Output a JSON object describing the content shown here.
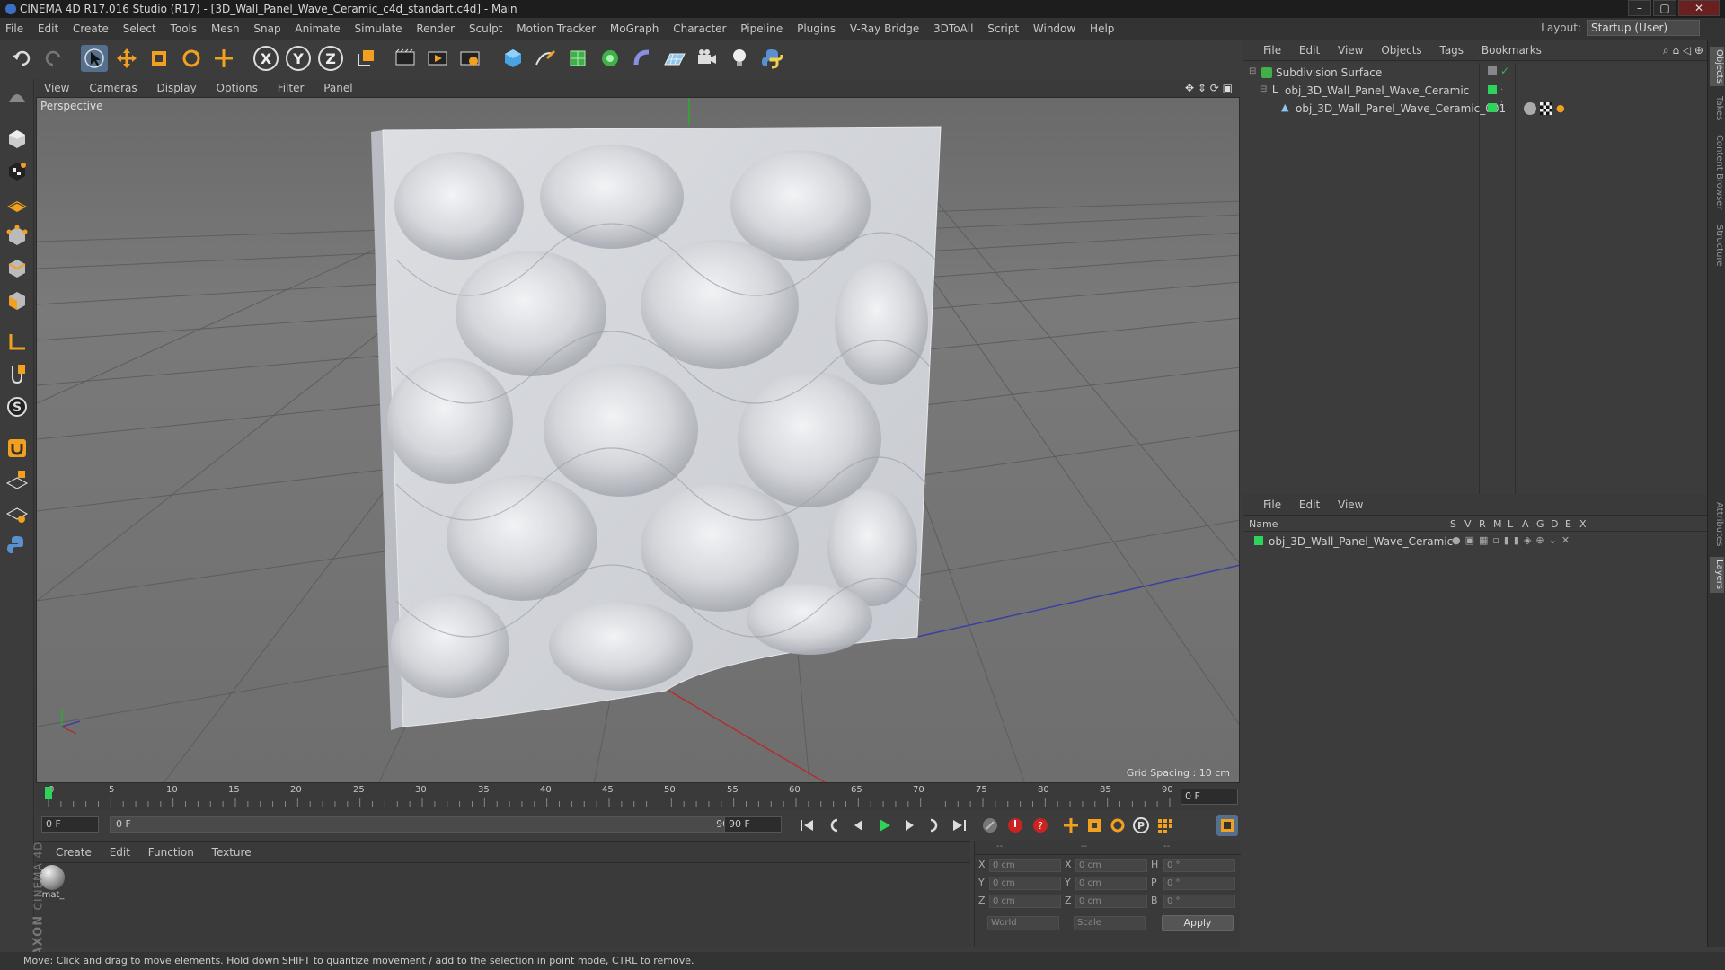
{
  "title_bar": {
    "text": "CINEMA 4D R17.016 Studio (R17) - [3D_Wall_Panel_Wave_Ceramic_c4d_standart.c4d] - Main"
  },
  "menu": [
    "File",
    "Edit",
    "Create",
    "Select",
    "Tools",
    "Mesh",
    "Snap",
    "Animate",
    "Simulate",
    "Render",
    "Sculpt",
    "Motion Tracker",
    "MoGraph",
    "Character",
    "Pipeline",
    "Plugins",
    "V-Ray Bridge",
    "3DToAll",
    "Script",
    "Window",
    "Help"
  ],
  "layout": {
    "label": "Layout:",
    "value": "Startup (User)"
  },
  "toolbar": {
    "x": "X",
    "y": "Y",
    "z": "Z"
  },
  "viewport": {
    "menu": [
      "View",
      "Cameras",
      "Display",
      "Options",
      "Filter",
      "Panel"
    ],
    "label": "Perspective",
    "grid_spacing": "Grid Spacing : 10 cm"
  },
  "object_manager": {
    "menu": [
      "File",
      "Edit",
      "View",
      "Objects",
      "Tags",
      "Bookmarks"
    ],
    "items": [
      {
        "name": "Subdivision Surface"
      },
      {
        "name": "obj_3D_Wall_Panel_Wave_Ceramic"
      },
      {
        "name": "obj_3D_Wall_Panel_Wave_Ceramic_001"
      }
    ]
  },
  "layer_manager": {
    "menu": [
      "File",
      "Edit",
      "View"
    ],
    "header": {
      "name": "Name",
      "cols": [
        "S",
        "V",
        "R",
        "M",
        "L",
        "A",
        "G",
        "D",
        "E",
        "X"
      ]
    },
    "items": [
      {
        "name": "obj_3D_Wall_Panel_Wave_Ceramic"
      }
    ]
  },
  "side_tabs": [
    "Objects",
    "Takes",
    "Content Browser",
    "Structure",
    "Attributes",
    "Layers"
  ],
  "timeline": {
    "ticks": [
      "0",
      "5",
      "10",
      "15",
      "20",
      "25",
      "30",
      "35",
      "40",
      "45",
      "50",
      "55",
      "60",
      "65",
      "70",
      "75",
      "80",
      "85",
      "90"
    ],
    "current_frame": "0 F",
    "start": "0 F",
    "range_start": "0 F",
    "range_end": "90 F",
    "end": "90 F"
  },
  "material_manager": {
    "menu": [
      "Create",
      "Edit",
      "Function",
      "Texture"
    ],
    "materials": [
      {
        "name": "mat_"
      }
    ]
  },
  "coordinates": {
    "header": [
      "--",
      "--",
      "--"
    ],
    "rows": [
      {
        "l1": "X",
        "v1": "0 cm",
        "l2": "X",
        "v2": "0 cm",
        "l3": "H",
        "v3": "0 °"
      },
      {
        "l1": "Y",
        "v1": "0 cm",
        "l2": "Y",
        "v2": "0 cm",
        "l3": "P",
        "v3": "0 °"
      },
      {
        "l1": "Z",
        "v1": "0 cm",
        "l2": "Z",
        "v2": "0 cm",
        "l3": "B",
        "v3": "0 °"
      }
    ],
    "mode": "World",
    "scale": "Scale",
    "apply": "Apply"
  },
  "status": "Move: Click and drag to move elements. Hold down SHIFT to quantize movement / add to the selection in point mode, CTRL to remove.",
  "brand": {
    "maxon": "MAXON",
    "c4d": "CINEMA 4D"
  }
}
